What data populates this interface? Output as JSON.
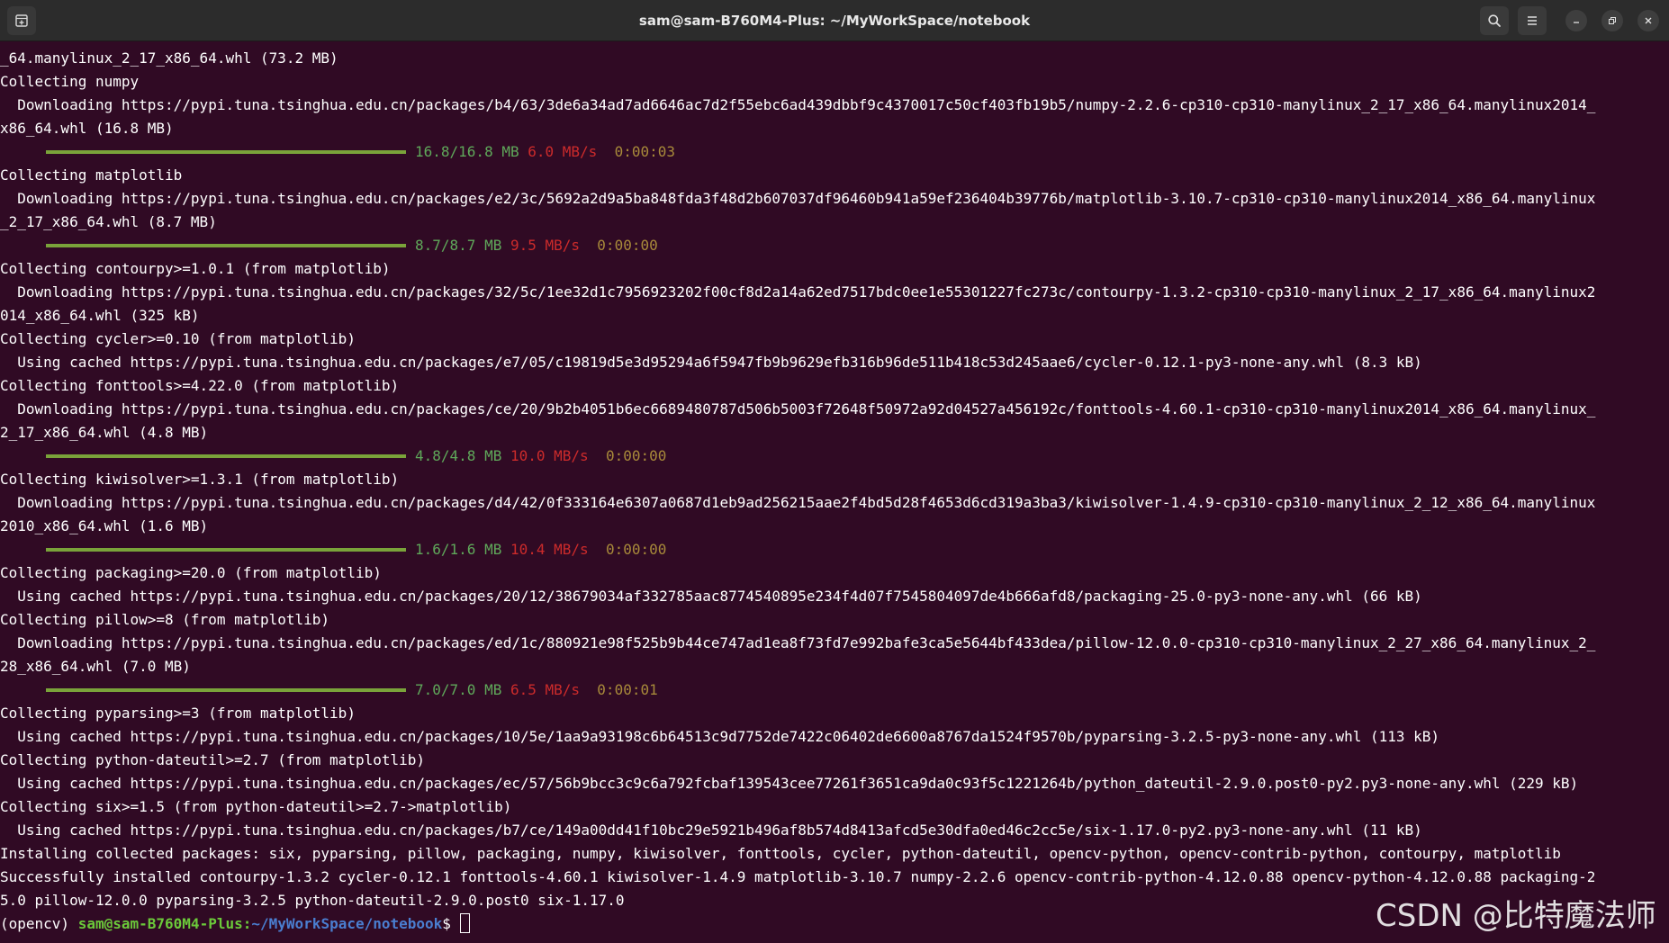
{
  "window": {
    "title": "sam@sam-B760M4-Plus: ~/MyWorkSpace/notebook",
    "icons": {
      "new_tab": "new-tab-icon",
      "search": "search-icon",
      "menu": "hamburger-menu-icon",
      "minimize": "minimize-icon",
      "maximize": "maximize-icon",
      "close": "close-icon"
    }
  },
  "colors": {
    "background": "#300a24",
    "titlebar": "#2c2c2c",
    "progress_fill": "#7aa33a",
    "size_text": "#5fa85a",
    "rate_text": "#cc2b2b",
    "eta_text": "#a88a3a",
    "prompt_user": "#6bc93a",
    "prompt_path": "#4a7ed0"
  },
  "lines": [
    {
      "type": "text",
      "text": "_64.manylinux_2_17_x86_64.whl (73.2 MB)"
    },
    {
      "type": "text",
      "text": "Collecting numpy"
    },
    {
      "type": "text",
      "text": "  Downloading https://pypi.tuna.tsinghua.edu.cn/packages/b4/63/3de6a34ad7ad6646ac7d2f55ebc6ad439dbbf9c4370017c50cf403fb19b5/numpy-2.2.6-cp310-cp310-manylinux_2_17_x86_64.manylinux2014_"
    },
    {
      "type": "text",
      "text": "x86_64.whl (16.8 MB)"
    },
    {
      "type": "progress",
      "fraction": 1.0,
      "size": "16.8/16.8 MB",
      "rate": "6.0 MB/s",
      "eta": "0:00:03"
    },
    {
      "type": "text",
      "text": "Collecting matplotlib"
    },
    {
      "type": "text",
      "text": "  Downloading https://pypi.tuna.tsinghua.edu.cn/packages/e2/3c/5692a2d9a5ba848fda3f48d2b607037df96460b941a59ef236404b39776b/matplotlib-3.10.7-cp310-cp310-manylinux2014_x86_64.manylinux"
    },
    {
      "type": "text",
      "text": "_2_17_x86_64.whl (8.7 MB)"
    },
    {
      "type": "progress",
      "fraction": 1.0,
      "size": "8.7/8.7 MB",
      "rate": "9.5 MB/s",
      "eta": "0:00:00"
    },
    {
      "type": "text",
      "text": "Collecting contourpy>=1.0.1 (from matplotlib)"
    },
    {
      "type": "text",
      "text": "  Downloading https://pypi.tuna.tsinghua.edu.cn/packages/32/5c/1ee32d1c7956923202f00cf8d2a14a62ed7517bdc0ee1e55301227fc273c/contourpy-1.3.2-cp310-cp310-manylinux_2_17_x86_64.manylinux2"
    },
    {
      "type": "text",
      "text": "014_x86_64.whl (325 kB)"
    },
    {
      "type": "text",
      "text": "Collecting cycler>=0.10 (from matplotlib)"
    },
    {
      "type": "text",
      "text": "  Using cached https://pypi.tuna.tsinghua.edu.cn/packages/e7/05/c19819d5e3d95294a6f5947fb9b9629efb316b96de511b418c53d245aae6/cycler-0.12.1-py3-none-any.whl (8.3 kB)"
    },
    {
      "type": "text",
      "text": "Collecting fonttools>=4.22.0 (from matplotlib)"
    },
    {
      "type": "text",
      "text": "  Downloading https://pypi.tuna.tsinghua.edu.cn/packages/ce/20/9b2b4051b6ec6689480787d506b5003f72648f50972a92d04527a456192c/fonttools-4.60.1-cp310-cp310-manylinux2014_x86_64.manylinux_"
    },
    {
      "type": "text",
      "text": "2_17_x86_64.whl (4.8 MB)"
    },
    {
      "type": "progress",
      "fraction": 1.0,
      "size": "4.8/4.8 MB",
      "rate": "10.0 MB/s",
      "eta": "0:00:00"
    },
    {
      "type": "text",
      "text": "Collecting kiwisolver>=1.3.1 (from matplotlib)"
    },
    {
      "type": "text",
      "text": "  Downloading https://pypi.tuna.tsinghua.edu.cn/packages/d4/42/0f333164e6307a0687d1eb9ad256215aae2f4bd5d28f4653d6cd319a3ba3/kiwisolver-1.4.9-cp310-cp310-manylinux_2_12_x86_64.manylinux"
    },
    {
      "type": "text",
      "text": "2010_x86_64.whl (1.6 MB)"
    },
    {
      "type": "progress",
      "fraction": 1.0,
      "size": "1.6/1.6 MB",
      "rate": "10.4 MB/s",
      "eta": "0:00:00"
    },
    {
      "type": "text",
      "text": "Collecting packaging>=20.0 (from matplotlib)"
    },
    {
      "type": "text",
      "text": "  Using cached https://pypi.tuna.tsinghua.edu.cn/packages/20/12/38679034af332785aac8774540895e234f4d07f7545804097de4b666afd8/packaging-25.0-py3-none-any.whl (66 kB)"
    },
    {
      "type": "text",
      "text": "Collecting pillow>=8 (from matplotlib)"
    },
    {
      "type": "text",
      "text": "  Downloading https://pypi.tuna.tsinghua.edu.cn/packages/ed/1c/880921e98f525b9b44ce747ad1ea8f73fd7e992bafe3ca5e5644bf433dea/pillow-12.0.0-cp310-cp310-manylinux_2_27_x86_64.manylinux_2_"
    },
    {
      "type": "text",
      "text": "28_x86_64.whl (7.0 MB)"
    },
    {
      "type": "progress",
      "fraction": 1.0,
      "size": "7.0/7.0 MB",
      "rate": "6.5 MB/s",
      "eta": "0:00:01"
    },
    {
      "type": "text",
      "text": "Collecting pyparsing>=3 (from matplotlib)"
    },
    {
      "type": "text",
      "text": "  Using cached https://pypi.tuna.tsinghua.edu.cn/packages/10/5e/1aa9a93198c6b64513c9d7752de7422c06402de6600a8767da1524f9570b/pyparsing-3.2.5-py3-none-any.whl (113 kB)"
    },
    {
      "type": "text",
      "text": "Collecting python-dateutil>=2.7 (from matplotlib)"
    },
    {
      "type": "text",
      "text": "  Using cached https://pypi.tuna.tsinghua.edu.cn/packages/ec/57/56b9bcc3c9c6a792fcbaf139543cee77261f3651ca9da0c93f5c1221264b/python_dateutil-2.9.0.post0-py2.py3-none-any.whl (229 kB)"
    },
    {
      "type": "text",
      "text": "Collecting six>=1.5 (from python-dateutil>=2.7->matplotlib)"
    },
    {
      "type": "text",
      "text": "  Using cached https://pypi.tuna.tsinghua.edu.cn/packages/b7/ce/149a00dd41f10bc29e5921b496af8b574d8413afcd5e30dfa0ed46c2cc5e/six-1.17.0-py2.py3-none-any.whl (11 kB)"
    },
    {
      "type": "text",
      "text": "Installing collected packages: six, pyparsing, pillow, packaging, numpy, kiwisolver, fonttools, cycler, python-dateutil, opencv-python, opencv-contrib-python, contourpy, matplotlib"
    },
    {
      "type": "text",
      "text": "Successfully installed contourpy-1.3.2 cycler-0.12.1 fonttools-4.60.1 kiwisolver-1.4.9 matplotlib-3.10.7 numpy-2.2.6 opencv-contrib-python-4.12.0.88 opencv-python-4.12.0.88 packaging-2"
    },
    {
      "type": "text",
      "text": "5.0 pillow-12.0.0 pyparsing-3.2.5 python-dateutil-2.9.0.post0 six-1.17.0"
    },
    {
      "type": "prompt",
      "env": "(opencv) ",
      "user_host": "sam@sam-B760M4-Plus",
      "sep": ":",
      "path": "~/MyWorkSpace/notebook",
      "dollar": "$ "
    }
  ],
  "watermark": "CSDN @比特魔法师"
}
